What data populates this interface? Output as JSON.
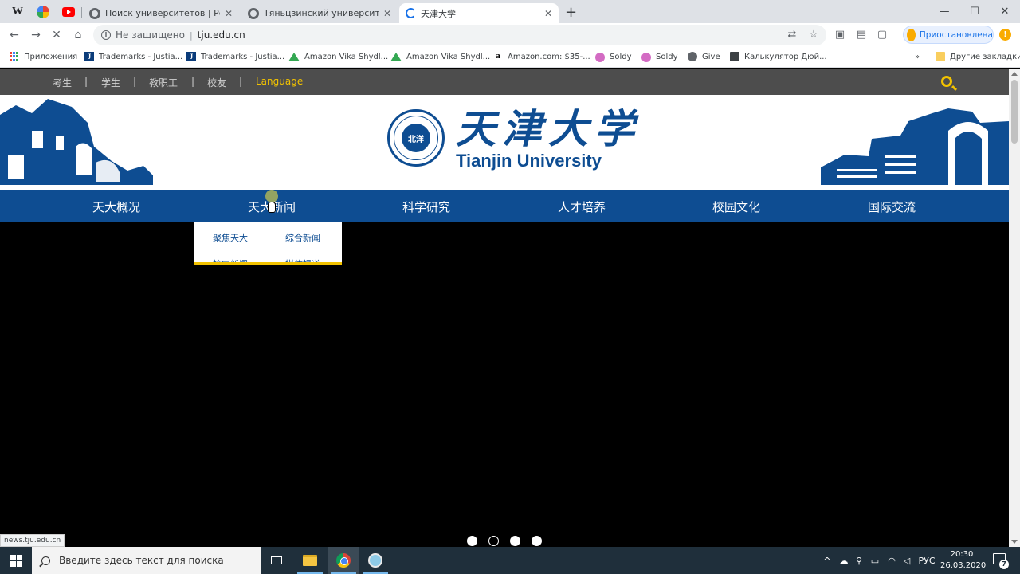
{
  "browser": {
    "tabs": [
      {
        "title": "Поиск университетов | Рейтинг"
      },
      {
        "title": "Тяньцзинский университет | Ст"
      },
      {
        "title": "天津大学"
      }
    ],
    "omnibox": {
      "security": "Не защищено",
      "url": "tju.edu.cn"
    },
    "profile_label": "Приостановлена",
    "status_url": "news.tju.edu.cn"
  },
  "bookmarks": {
    "items": [
      {
        "label": "Приложения",
        "icon": "apps-icon"
      },
      {
        "label": "Trademarks - Justia...",
        "icon": "justia-icon"
      },
      {
        "label": "Trademarks - Justia...",
        "icon": "justia-icon"
      },
      {
        "label": "Amazon Vika Shydl...",
        "icon": "google-drive-icon"
      },
      {
        "label": "Amazon Vika Shydl...",
        "icon": "google-drive-icon"
      },
      {
        "label": "Amazon.com: $35-...",
        "icon": "amazon-icon"
      },
      {
        "label": "Soldy",
        "icon": "soldy-icon"
      },
      {
        "label": "Soldy",
        "icon": "soldy-icon"
      },
      {
        "label": "Give",
        "icon": "give-icon"
      },
      {
        "label": "Калькулятор Дюй...",
        "icon": "calculator-icon"
      }
    ],
    "more": "»",
    "other": "Другие закладки"
  },
  "site": {
    "topbar": {
      "links": [
        "考生",
        "学生",
        "教职工",
        "校友"
      ],
      "language": "Language"
    },
    "logo": {
      "cn": "天津大学",
      "en": "Tianjin University",
      "seal_text": "北洋"
    },
    "nav": [
      "天大概况",
      "天大新闻",
      "科学研究",
      "人才培养",
      "校园文化",
      "国际交流"
    ],
    "dropdown": [
      "聚焦天大",
      "综合新闻",
      "校内新闻",
      "媒体报道"
    ],
    "carousel": {
      "slides": 4,
      "active": 1
    }
  },
  "taskbar": {
    "search_placeholder": "Введите здесь текст для поиска",
    "lang": "РУС",
    "time": "20:30",
    "date": "26.03.2020",
    "notifications": "7"
  },
  "colors": {
    "brand_blue": "#0e4d92",
    "accent_yellow": "#f2c200"
  }
}
